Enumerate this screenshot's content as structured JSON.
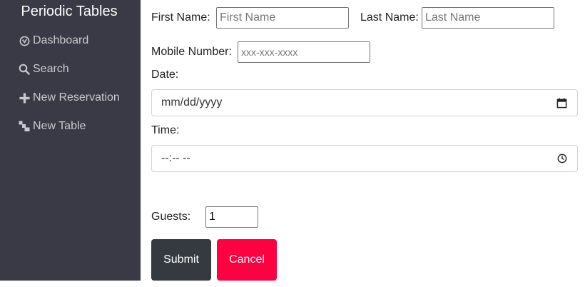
{
  "app": {
    "title": "Periodic Tables"
  },
  "sidebar": {
    "items": [
      {
        "label": "Dashboard",
        "icon": "dashboard-icon"
      },
      {
        "label": "Search",
        "icon": "search-icon"
      },
      {
        "label": "New Reservation",
        "icon": "plus-icon"
      },
      {
        "label": "New Table",
        "icon": "table-icon"
      }
    ]
  },
  "form": {
    "first_name": {
      "label": "First Name:",
      "placeholder": "First Name",
      "value": ""
    },
    "last_name": {
      "label": "Last Name:",
      "placeholder": "Last Name",
      "value": ""
    },
    "mobile": {
      "label": "Mobile Number:",
      "placeholder": "xxx-xxx-xxxx",
      "value": ""
    },
    "date": {
      "label": "Date:",
      "display": "mm/dd/yyyy"
    },
    "time": {
      "label": "Time:",
      "display": "--:-- --"
    },
    "guests": {
      "label": "Guests:",
      "value": "1"
    },
    "submit_label": "Submit",
    "cancel_label": "Cancel"
  },
  "colors": {
    "sidebar_bg": "#393a45",
    "submit_bg": "#343a40",
    "cancel_bg": "#ff0040"
  }
}
